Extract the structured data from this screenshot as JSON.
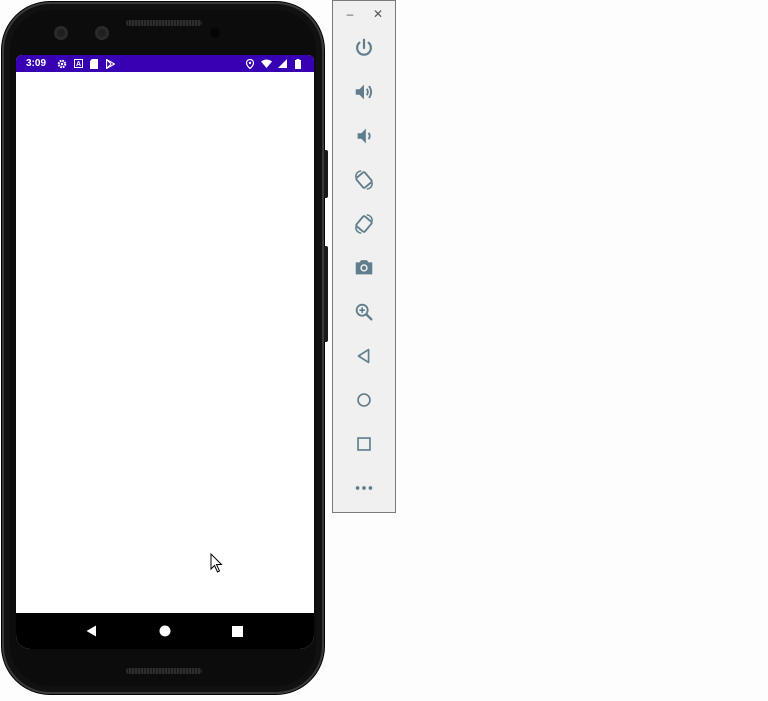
{
  "status_bar": {
    "time": "3:09",
    "left_icons": [
      "gear-icon",
      "a-box-icon",
      "sd-card-icon",
      "play-store-icon"
    ],
    "right_icons": [
      "location-icon",
      "wifi-icon",
      "signal-icon",
      "battery-icon"
    ],
    "color": "#3700b3"
  },
  "navbar": {
    "buttons": [
      "back",
      "home",
      "recents"
    ]
  },
  "window_controls": {
    "minimize": "–",
    "close": "✕"
  },
  "toolbar": {
    "buttons": [
      "power",
      "volume-up",
      "volume-down",
      "rotate-left",
      "rotate-right",
      "screenshot",
      "zoom",
      "back",
      "home",
      "overview",
      "more"
    ],
    "icon_color": "#607d8b"
  }
}
